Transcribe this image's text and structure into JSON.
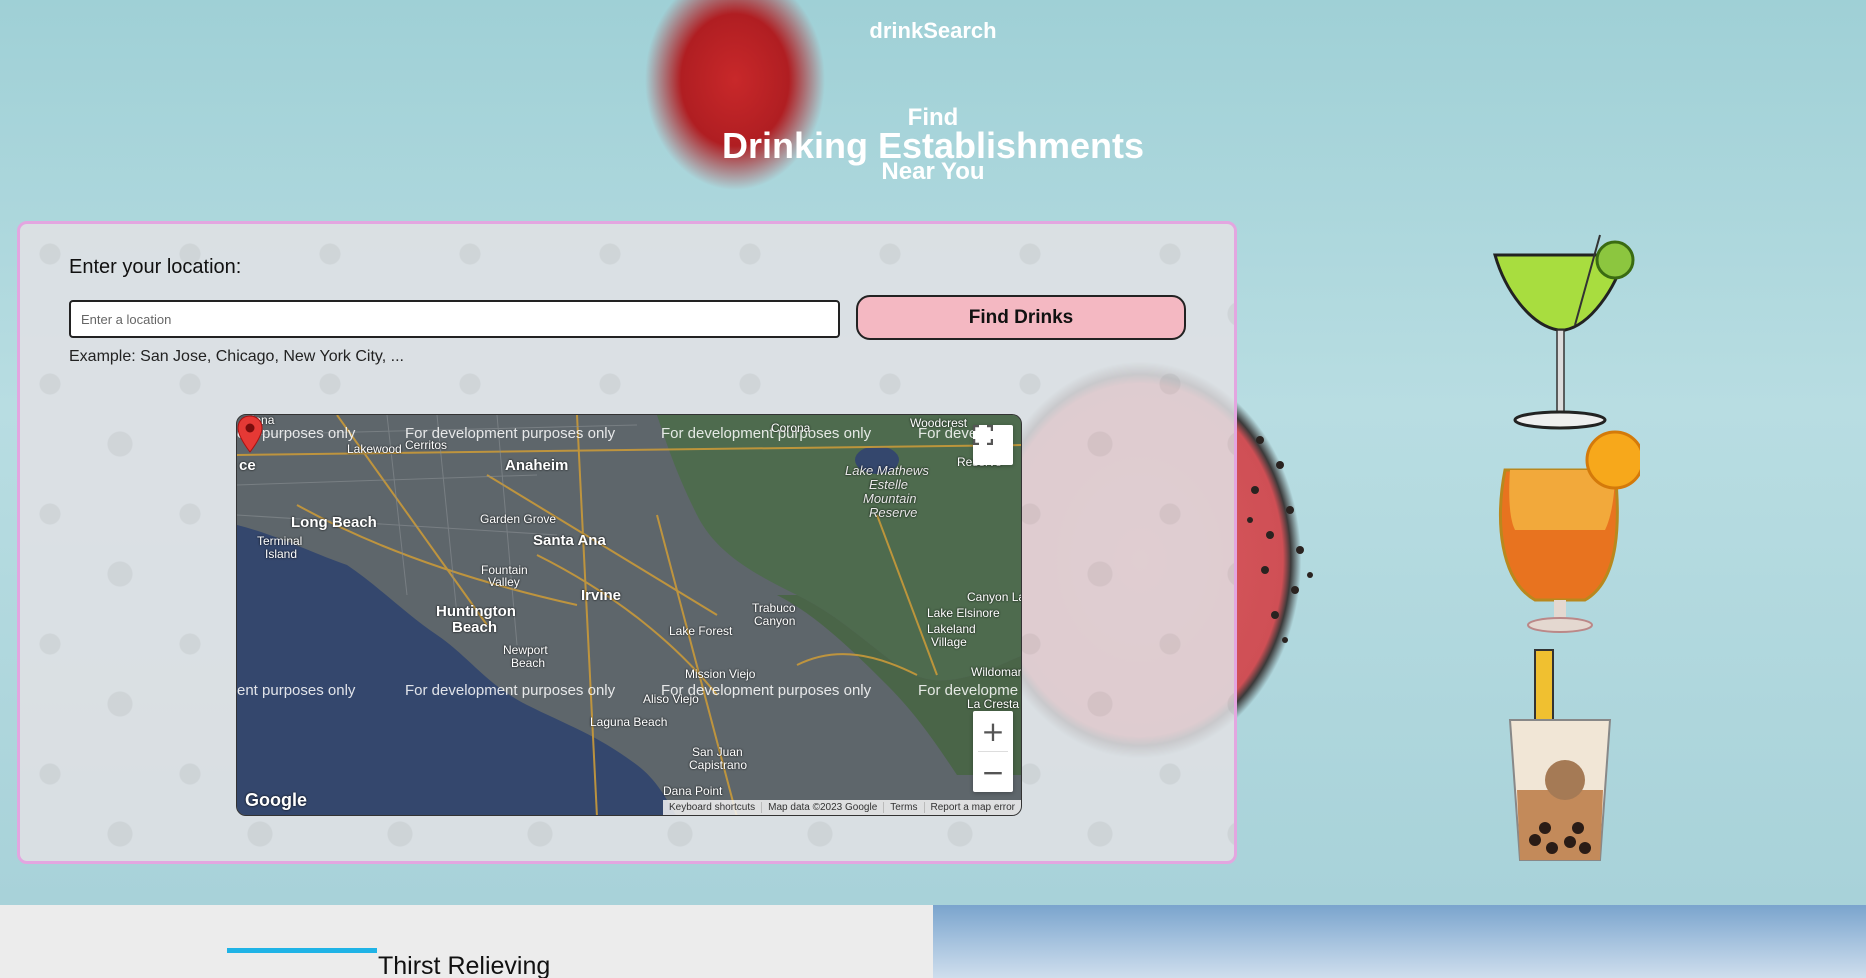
{
  "nav": {
    "title": "drinkSearch"
  },
  "hero": {
    "line1": "Find",
    "line2": "Drinking Establishments",
    "line3": "Near You"
  },
  "search": {
    "label": "Enter your location:",
    "placeholder": "Enter a location",
    "value": "",
    "button_label": "Find Drinks",
    "example": "Example: San Jose, Chicago, New York City, ..."
  },
  "map": {
    "watermark": "For development purposes only",
    "watermark_cut_left": "ent purposes only",
    "watermark_cut_right_top": "For develo",
    "watermark_cut_right_bottom": "For developme",
    "labels": {
      "anaheim": "Anaheim",
      "long_beach": "Long Beach",
      "santa_ana": "Santa Ana",
      "huntington": "Huntington",
      "beach": "Beach",
      "irvine": "Irvine",
      "garden_grove": "Garden Grove",
      "fountain": "Fountain",
      "valley": "Valley",
      "lakewood": "Lakewood",
      "cerritos": "Cerritos",
      "terminal": "Terminal",
      "island": "Island",
      "newport": "Newport",
      "beach2": "Beach",
      "lake_forest": "Lake Forest",
      "mission_viejo": "Mission Viejo",
      "aliso_viejo": "Aliso Viejo",
      "laguna_beach": "Laguna Beach",
      "san_juan": "San Juan",
      "capistrano": "Capistrano",
      "dana_point": "Dana Point",
      "trabuco": "Trabuco",
      "canyon": "Canyon",
      "lake_mathews": "Lake Mathews",
      "estelle": "Estelle",
      "mountain": "Mountain",
      "reserve": "Reserve",
      "woodcrest": "Woodcrest",
      "reserve2": "Reserve",
      "canyon_lake": "Canyon Lak",
      "lake_elsinore": "Lake Elsinore",
      "lakeland": "Lakeland",
      "village": "Village",
      "wildomar": "Wildomar",
      "la_cresta": "La Cresta",
      "ce": "ce",
      "corona": "Corona",
      "adena": "adena"
    },
    "zoom_in": "+",
    "zoom_out": "−",
    "footer": [
      "Keyboard shortcuts",
      "Map data ©2023 Google",
      "Terms",
      "Report a map error"
    ],
    "logo": "Google"
  },
  "section": {
    "title": "Thirst Relieving"
  },
  "colors": {
    "accent_pink": "#f4b8c2",
    "panel_border": "#e3a6e0",
    "accent_blue": "#1fb3e6"
  }
}
